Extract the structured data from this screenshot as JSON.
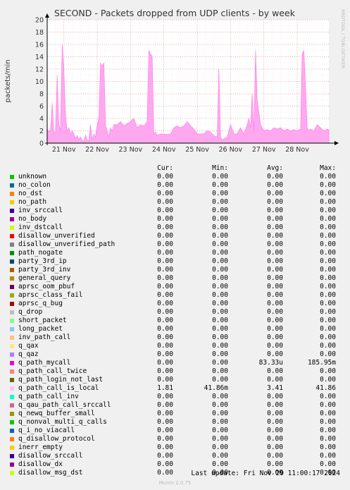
{
  "chart_data": {
    "type": "area",
    "title": "SECOND - Packets dropped from UDP clients - by week",
    "ylabel": "packets/min",
    "side_label": "RRDTOOL / TOBI OETIKER",
    "ylim": [
      0,
      20
    ],
    "yticks": [
      0,
      2,
      4,
      6,
      8,
      10,
      12,
      14,
      16,
      18,
      20
    ],
    "x_tick_labels": [
      "21 Nov",
      "22 Nov",
      "23 Nov",
      "24 Nov",
      "25 Nov",
      "26 Nov",
      "27 Nov",
      "28 Nov"
    ],
    "xlim_days": [
      0,
      8.45
    ],
    "grid": true,
    "series_color": "#ffa8f0",
    "series_line_color": "#ff77e6",
    "series": [
      {
        "name": "q_path_call_is_local",
        "x_days": [
          0.0,
          0.05,
          0.1,
          0.15,
          0.2,
          0.25,
          0.3,
          0.35,
          0.4,
          0.45,
          0.5,
          0.55,
          0.6,
          0.65,
          0.7,
          0.75,
          0.8,
          0.85,
          0.9,
          0.95,
          1.0,
          1.05,
          1.1,
          1.15,
          1.2,
          1.25,
          1.3,
          1.35,
          1.4,
          1.45,
          1.5,
          1.55,
          1.6,
          1.65,
          1.7,
          1.75,
          1.8,
          1.85,
          1.9,
          1.95,
          2.0,
          2.1,
          2.2,
          2.3,
          2.4,
          2.5,
          2.6,
          2.7,
          2.8,
          2.9,
          3.0,
          3.05,
          3.1,
          3.15,
          3.2,
          3.25,
          3.3,
          3.4,
          3.5,
          3.6,
          3.7,
          3.8,
          3.9,
          4.0,
          4.1,
          4.2,
          4.3,
          4.4,
          4.5,
          4.6,
          4.7,
          4.8,
          4.9,
          5.0,
          5.1,
          5.15,
          5.2,
          5.25,
          5.3,
          5.4,
          5.5,
          5.6,
          5.7,
          5.8,
          5.9,
          6.0,
          6.05,
          6.1,
          6.15,
          6.2,
          6.25,
          6.3,
          6.4,
          6.5,
          6.6,
          6.7,
          6.8,
          6.9,
          7.0,
          7.1,
          7.2,
          7.3,
          7.4,
          7.5,
          7.6,
          7.65,
          7.7,
          7.75,
          7.8,
          7.85,
          7.9,
          8.0,
          8.1,
          8.2,
          8.3,
          8.4,
          8.45
        ],
        "y": [
          2.4,
          1.8,
          2.2,
          6.5,
          1.5,
          2.0,
          11.0,
          3.0,
          2.0,
          16.0,
          12.0,
          4.5,
          2.0,
          2.5,
          1.5,
          2.0,
          1.5,
          0.8,
          1.2,
          0.6,
          1.0,
          0.5,
          0.3,
          1.3,
          0.5,
          0.4,
          3.0,
          0.5,
          1.5,
          1.0,
          3.0,
          4.0,
          13.0,
          12.5,
          13.0,
          3.0,
          2.0,
          1.0,
          2.5,
          2.0,
          3.0,
          3.0,
          3.5,
          2.8,
          3.2,
          3.5,
          4.0,
          2.5,
          3.0,
          2.8,
          3.5,
          15.0,
          14.5,
          14.0,
          1.5,
          1.8,
          1.3,
          1.5,
          1.5,
          1.4,
          1.5,
          2.5,
          2.8,
          2.5,
          2.8,
          3.5,
          2.8,
          2.3,
          1.5,
          1.5,
          1.5,
          2.0,
          1.8,
          1.2,
          1.0,
          12.0,
          1.0,
          0.5,
          0.7,
          1.0,
          3.0,
          1.5,
          1.5,
          2.5,
          1.5,
          3.0,
          4.0,
          2.5,
          8.0,
          2.0,
          15.0,
          7.0,
          3.0,
          2.0,
          2.2,
          2.0,
          2.5,
          2.3,
          2.5,
          2.0,
          2.3,
          2.0,
          2.2,
          2.0,
          2.3,
          14.5,
          15.0,
          9.0,
          2.5,
          2.0,
          2.3,
          2.0,
          3.0,
          2.5,
          2.0,
          2.3,
          2.2
        ]
      }
    ]
  },
  "legend": {
    "headers": {
      "cur": "Cur:",
      "min": "Min:",
      "avg": "Avg:",
      "max": "Max:"
    },
    "rows": [
      {
        "name": "unknown",
        "color": "#00cc00",
        "cur": "0.00",
        "min": "0.00",
        "avg": "0.00",
        "max": "0.00"
      },
      {
        "name": "no_colon",
        "color": "#0066b3",
        "cur": "0.00",
        "min": "0.00",
        "avg": "0.00",
        "max": "0.00"
      },
      {
        "name": "no_dst",
        "color": "#ff8000",
        "cur": "0.00",
        "min": "0.00",
        "avg": "0.00",
        "max": "0.00"
      },
      {
        "name": "no_path",
        "color": "#ffcc00",
        "cur": "0.00",
        "min": "0.00",
        "avg": "0.00",
        "max": "0.00"
      },
      {
        "name": "inv_srccall",
        "color": "#330099",
        "cur": "0.00",
        "min": "0.00",
        "avg": "0.00",
        "max": "0.00"
      },
      {
        "name": "no_body",
        "color": "#990099",
        "cur": "0.00",
        "min": "0.00",
        "avg": "0.00",
        "max": "0.00"
      },
      {
        "name": "inv_dstcall",
        "color": "#ccff00",
        "cur": "0.00",
        "min": "0.00",
        "avg": "0.00",
        "max": "0.00"
      },
      {
        "name": "disallow_unverified",
        "color": "#ff0000",
        "cur": "0.00",
        "min": "0.00",
        "avg": "0.00",
        "max": "0.00"
      },
      {
        "name": "disallow_unverified_path",
        "color": "#808080",
        "cur": "0.00",
        "min": "0.00",
        "avg": "0.00",
        "max": "0.00"
      },
      {
        "name": "path_nogate",
        "color": "#008f00",
        "cur": "0.00",
        "min": "0.00",
        "avg": "0.00",
        "max": "0.00"
      },
      {
        "name": "party_3rd_ip",
        "color": "#00487d",
        "cur": "0.00",
        "min": "0.00",
        "avg": "0.00",
        "max": "0.00"
      },
      {
        "name": "party_3rd_inv",
        "color": "#b35a00",
        "cur": "0.00",
        "min": "0.00",
        "avg": "0.00",
        "max": "0.00"
      },
      {
        "name": "general_query",
        "color": "#b38f00",
        "cur": "0.00",
        "min": "0.00",
        "avg": "0.00",
        "max": "0.00"
      },
      {
        "name": "aprsc_oom_pbuf",
        "color": "#6b006b",
        "cur": "0.00",
        "min": "0.00",
        "avg": "0.00",
        "max": "0.00"
      },
      {
        "name": "aprsc_class_fail",
        "color": "#8fb300",
        "cur": "0.00",
        "min": "0.00",
        "avg": "0.00",
        "max": "0.00"
      },
      {
        "name": "aprsc_q_bug",
        "color": "#b30000",
        "cur": "0.00",
        "min": "0.00",
        "avg": "0.00",
        "max": "0.00"
      },
      {
        "name": "q_drop",
        "color": "#bebebe",
        "cur": "0.00",
        "min": "0.00",
        "avg": "0.00",
        "max": "0.00"
      },
      {
        "name": "short_packet",
        "color": "#80ff80",
        "cur": "0.00",
        "min": "0.00",
        "avg": "0.00",
        "max": "0.00"
      },
      {
        "name": "long_packet",
        "color": "#80c9ff",
        "cur": "0.00",
        "min": "0.00",
        "avg": "0.00",
        "max": "0.00"
      },
      {
        "name": "inv_path_call",
        "color": "#ffc080",
        "cur": "0.00",
        "min": "0.00",
        "avg": "0.00",
        "max": "0.00"
      },
      {
        "name": "q_qax",
        "color": "#ffe680",
        "cur": "0.00",
        "min": "0.00",
        "avg": "0.00",
        "max": "0.00"
      },
      {
        "name": "q_qaz",
        "color": "#aa80ff",
        "cur": "0.00",
        "min": "0.00",
        "avg": "0.00",
        "max": "0.00"
      },
      {
        "name": "q_path_mycall",
        "color": "#ee00cc",
        "cur": "0.00",
        "min": "0.00",
        "avg": "83.33u",
        "max": "185.95m"
      },
      {
        "name": "q_path_call_twice",
        "color": "#ff8080",
        "cur": "0.00",
        "min": "0.00",
        "avg": "0.00",
        "max": "0.00"
      },
      {
        "name": "q_path_login_not_last",
        "color": "#666600",
        "cur": "0.00",
        "min": "0.00",
        "avg": "0.00",
        "max": "0.00"
      },
      {
        "name": "q_path_call_is_local",
        "color": "#ffbfff",
        "cur": "1.81",
        "min": "41.86m",
        "avg": "3.41",
        "max": "41.86"
      },
      {
        "name": "q_path_call_inv",
        "color": "#00ffcc",
        "cur": "0.00",
        "min": "0.00",
        "avg": "0.00",
        "max": "0.00"
      },
      {
        "name": "q_qau_path_call_srccall",
        "color": "#cc6699",
        "cur": "0.00",
        "min": "0.00",
        "avg": "0.00",
        "max": "0.00"
      },
      {
        "name": "q_newq_buffer_small",
        "color": "#999900",
        "cur": "0.00",
        "min": "0.00",
        "avg": "0.00",
        "max": "0.00"
      },
      {
        "name": "q_nonval_multi_q_calls",
        "color": "#00cc00",
        "cur": "0.00",
        "min": "0.00",
        "avg": "0.00",
        "max": "0.00"
      },
      {
        "name": "q_i_no_viacall",
        "color": "#0066b3",
        "cur": "0.00",
        "min": "0.00",
        "avg": "0.00",
        "max": "0.00"
      },
      {
        "name": "q_disallow_protocol",
        "color": "#ff8000",
        "cur": "0.00",
        "min": "0.00",
        "avg": "0.00",
        "max": "0.00"
      },
      {
        "name": "inerr_empty",
        "color": "#ffcc00",
        "cur": "0.00",
        "min": "0.00",
        "avg": "0.00",
        "max": "0.00"
      },
      {
        "name": "disallow_srccall",
        "color": "#330099",
        "cur": "0.00",
        "min": "0.00",
        "avg": "0.00",
        "max": "0.00"
      },
      {
        "name": "disallow_dx",
        "color": "#990099",
        "cur": "0.00",
        "min": "0.00",
        "avg": "0.00",
        "max": "0.00"
      },
      {
        "name": "disallow_msg_dst",
        "color": "#ccff00",
        "cur": "0.00",
        "min": "0.00",
        "avg": "0.00",
        "max": "0.00"
      }
    ]
  },
  "footer": {
    "last_update": "Last update: Fri Nov 29 11:00:17 2024",
    "munin_version": "Munin 2.0.75"
  }
}
